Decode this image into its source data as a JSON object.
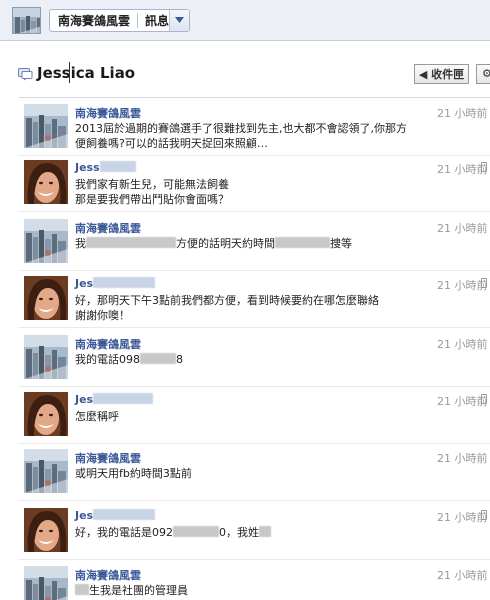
{
  "topbar": {
    "page_name": "南海賽鴿風雲",
    "mode_label": "訊息"
  },
  "header": {
    "title": "Jessica Liao",
    "inbox_button": "◀ 收件匣",
    "more_button": "⚙"
  },
  "messages": [
    {
      "sender": "南海賽鴿風雲",
      "avatar": "city",
      "time": "21 小時前",
      "body": "2013屆於過期的賽鴿選手了很難找到先主,也大都不會認領了,你那方便飼養嗎?可以的話我明天捉回來照顧…",
      "device_icon": false
    },
    {
      "sender": "Jess",
      "avatar": "person",
      "time": "21 小時前",
      "body": "我們家有新生兒，可能無法飼養\n那是要我們帶出鬥貼你會面嗎？",
      "device_icon": true
    },
    {
      "sender": "南海賽鴿風雲",
      "avatar": "city",
      "time": "21 小時前",
      "body_before": "我",
      "body_mid": "方便的話明天約時間",
      "body_after": "捜等",
      "device_icon": false
    },
    {
      "sender": "Jes",
      "avatar": "person",
      "time": "21 小時前",
      "body": "好，那明天下午3點前我們都方便，看到時候要約在哪怎麼聯絡\n謝謝你噢！",
      "device_icon": true
    },
    {
      "sender": "南海賽鴿風雲",
      "avatar": "city",
      "time": "21 小時前",
      "body_before": "我的電話098",
      "body_after": "8",
      "device_icon": false
    },
    {
      "sender": "Jes",
      "avatar": "person",
      "time": "21 小時前",
      "body": "怎麼稱呼",
      "device_icon": true
    },
    {
      "sender": "南海賽鴿風雲",
      "avatar": "city",
      "time": "21 小時前",
      "body": "或明天用fb約時間3點前",
      "device_icon": false
    },
    {
      "sender": "Jes",
      "avatar": "person",
      "time": "21 小時前",
      "body_before": "好，我的電話是092",
      "body_after": "0，我姓",
      "device_icon": true
    },
    {
      "sender": "南海賽鴿風雲",
      "avatar": "city",
      "time": "21 小時前",
      "body_before": "",
      "body_after": "生我是社團的管理員",
      "device_icon": false
    }
  ]
}
